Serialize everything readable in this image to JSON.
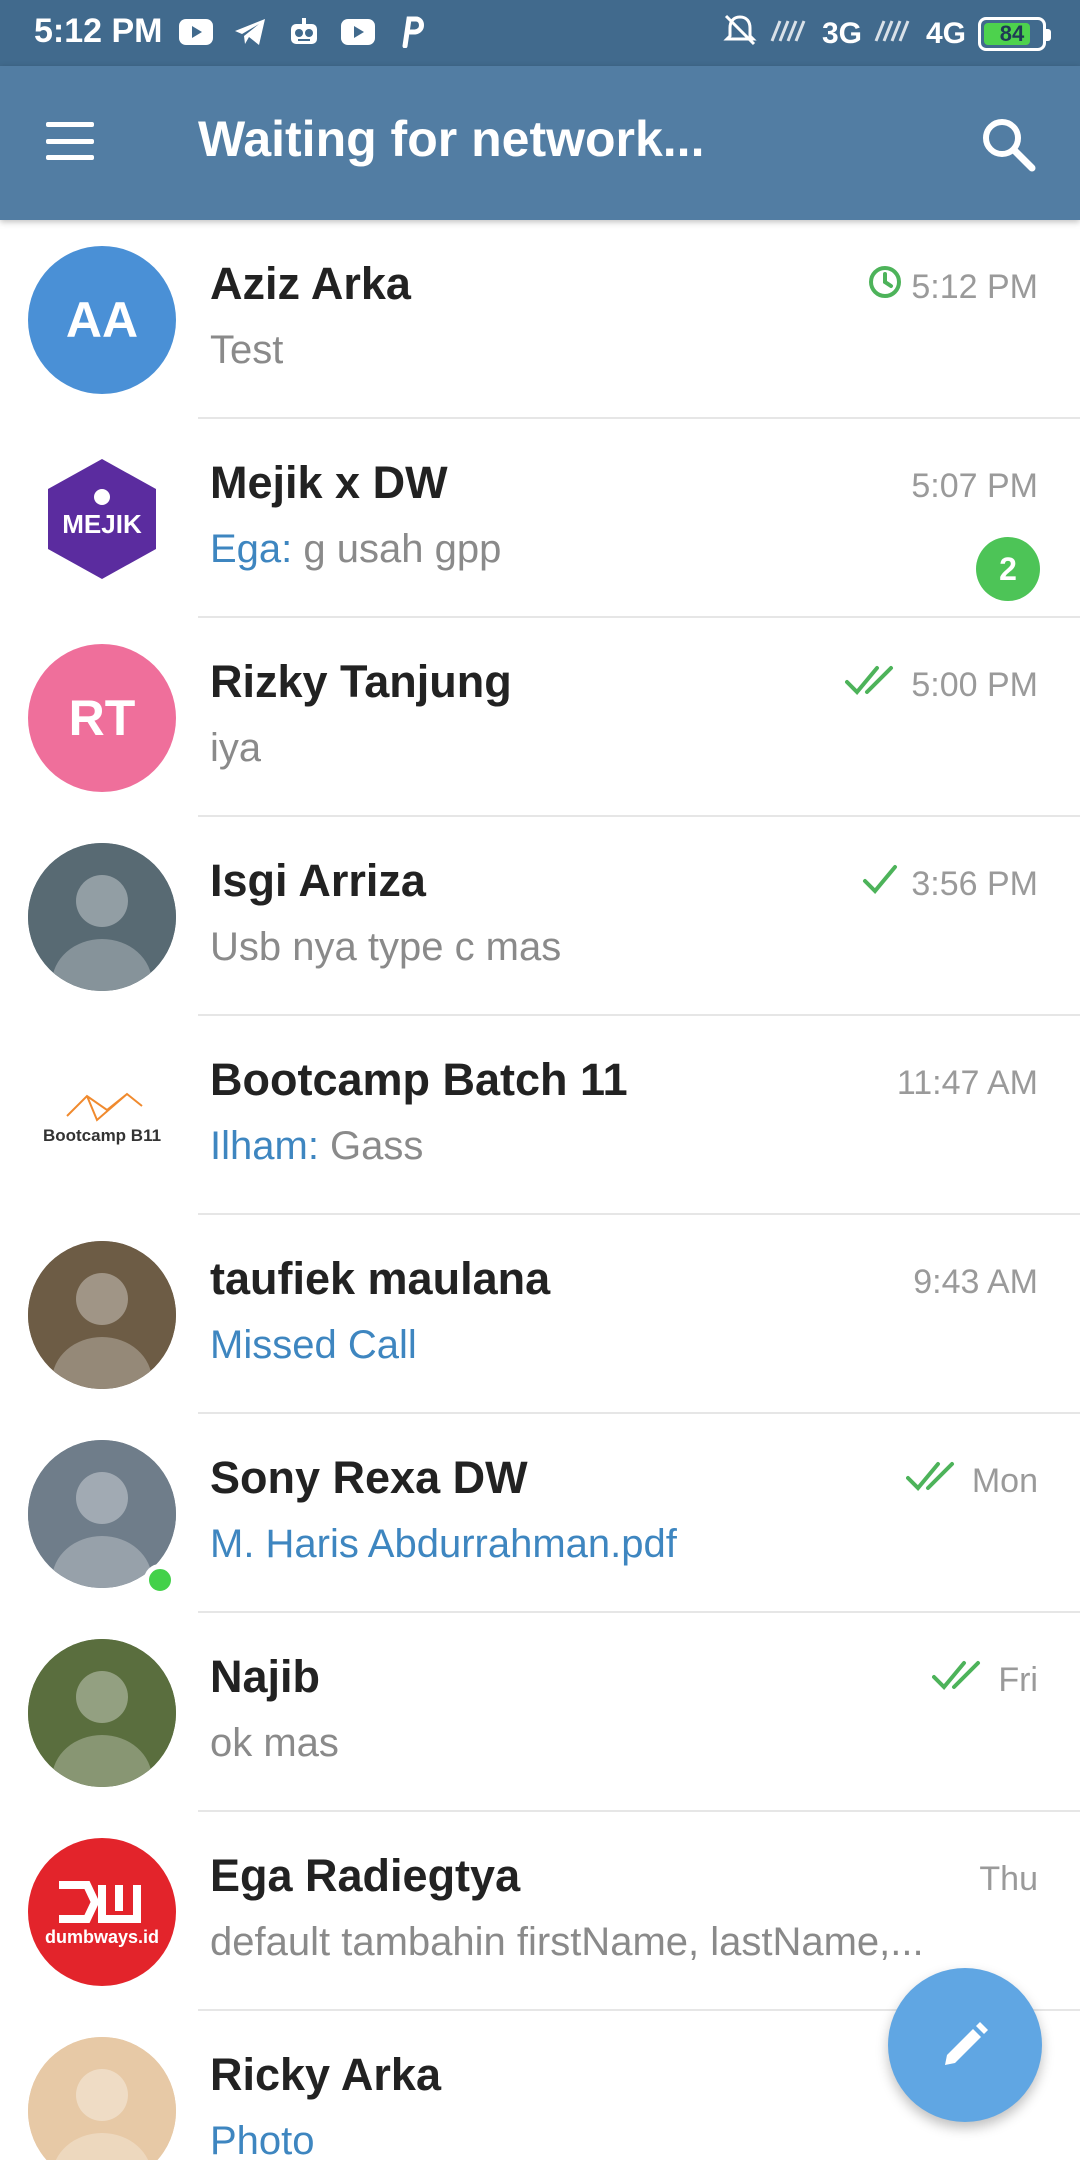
{
  "status_bar": {
    "time": "5:12 PM",
    "network_3g": "3G",
    "network_4g": "4G",
    "battery_level": "84",
    "battery_fraction": 0.84,
    "left_icons": [
      "youtube-icon",
      "telegram-icon",
      "robot-icon",
      "youtube-icon",
      "p-icon"
    ],
    "right_icons": [
      "muted-alarm-icon",
      "signal-icon",
      "signal-icon",
      "battery-icon"
    ]
  },
  "appbar": {
    "title": "Waiting for network..."
  },
  "chats": [
    {
      "name": "Aziz Arka",
      "time": "5:12 PM",
      "status": "pending-clock",
      "sender": "",
      "preview": "Test",
      "preview_style": "grey",
      "avatar_initials": "AA",
      "avatar_color": "#4a90d6"
    },
    {
      "name": "Mejik x DW",
      "time": "5:07 PM",
      "status": "",
      "sender": "Ega:",
      "preview": " g usah gpp",
      "preview_style": "grey",
      "badge": "2",
      "avatar_initials": "MEJIK",
      "avatar_color": "#5b2c9f"
    },
    {
      "name": "Rizky Tanjung",
      "time": "5:00 PM",
      "status": "double-check",
      "sender": "",
      "preview": "iya",
      "preview_style": "grey",
      "avatar_initials": "RT",
      "avatar_color": "#ef6f9b"
    },
    {
      "name": "Isgi Arriza",
      "time": "3:56 PM",
      "status": "single-check",
      "sender": "",
      "preview": "Usb nya type c mas",
      "preview_style": "grey",
      "avatar_initials": "",
      "avatar_color": "#586a73"
    },
    {
      "name": "Bootcamp Batch 11",
      "time": "11:47 AM",
      "status": "",
      "sender": "Ilham:",
      "preview": " Gass",
      "preview_style": "grey",
      "avatar_initials": "Bootcamp B11",
      "avatar_color": "#ffffff"
    },
    {
      "name": "taufiek maulana",
      "time": "9:43 AM",
      "status": "",
      "sender": "",
      "preview": "Missed Call",
      "preview_style": "blue",
      "avatar_initials": "",
      "avatar_color": "#6d5c45"
    },
    {
      "name": "Sony Rexa DW",
      "time": "Mon",
      "status": "double-check",
      "sender": "",
      "preview": "M. Haris Abdurrahman.pdf",
      "preview_style": "blue",
      "online": true,
      "avatar_initials": "",
      "avatar_color": "#6f7d8a"
    },
    {
      "name": "Najib",
      "time": "Fri",
      "status": "double-check",
      "sender": "",
      "preview": "ok mas",
      "preview_style": "grey",
      "avatar_initials": "",
      "avatar_color": "#5a6e3e"
    },
    {
      "name": "Ega Radiegtya",
      "time": "Thu",
      "status": "",
      "sender": "",
      "preview": "default tambahin firstName, lastName,...",
      "preview_style": "grey",
      "avatar_initials": "dumbways.id",
      "avatar_color": "#e3242b"
    },
    {
      "name": "Ricky Arka",
      "time": "",
      "status": "",
      "sender": "",
      "preview": "Photo",
      "preview_style": "blue",
      "avatar_initials": "",
      "avatar_color": "#e7c9a6"
    }
  ],
  "fab": {
    "icon": "pencil-icon"
  },
  "colors": {
    "statusbar": "#416a8d",
    "appbar": "#527da3",
    "accent_blue": "#3e86c0",
    "check_green": "#4db35a",
    "badge_green": "#4dc457"
  }
}
